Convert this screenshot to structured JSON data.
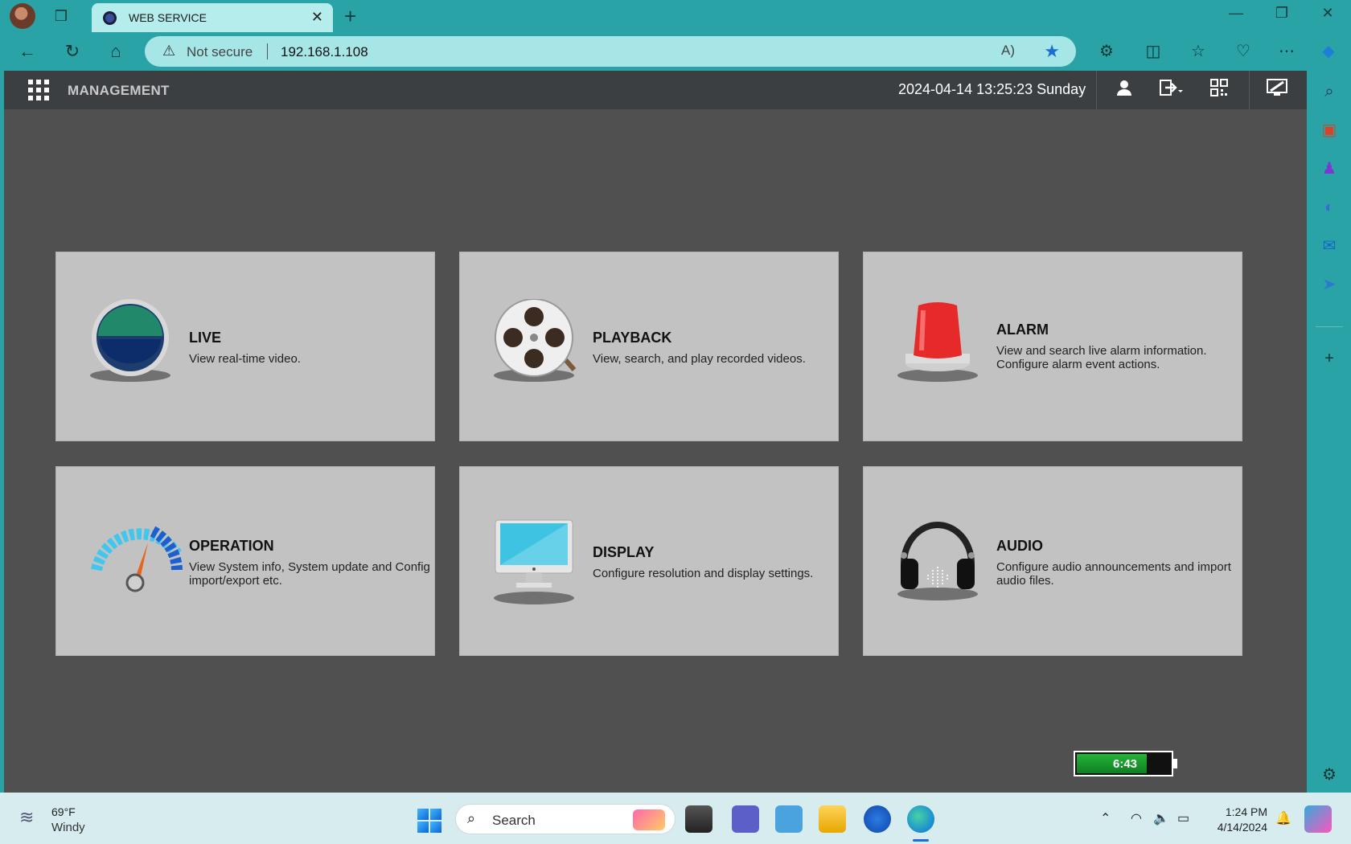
{
  "browser": {
    "tab_title": "WEB SERVICE",
    "tab_close": "✕",
    "new_tab": "+",
    "minimize": "—",
    "restore": "❐",
    "close": "✕",
    "security_label": "Not secure",
    "url": "192.168.1.108",
    "read_aloud": "A)",
    "back": "←",
    "refresh": "↻",
    "home": "⌂"
  },
  "app": {
    "title": "MANAGEMENT",
    "datetime": "2024-04-14 13:25:23 Sunday",
    "battery_time": "6:43",
    "battery_level_percent": 75,
    "cards": [
      {
        "title": "LIVE",
        "desc": "View real-time video."
      },
      {
        "title": "PLAYBACK",
        "desc": "View, search, and play recorded videos."
      },
      {
        "title": "ALARM",
        "desc": "View and search live alarm information. Configure alarm event actions."
      },
      {
        "title": "OPERATION",
        "desc": "View System info, System update and Config import/export etc."
      },
      {
        "title": "DISPLAY",
        "desc": "Configure resolution and display settings."
      },
      {
        "title": "AUDIO",
        "desc": "Configure audio announcements and import audio files."
      }
    ]
  },
  "taskbar": {
    "temperature": "69°F",
    "condition": "Windy",
    "search_label": "Search",
    "time": "1:24 PM",
    "date": "4/14/2024"
  }
}
